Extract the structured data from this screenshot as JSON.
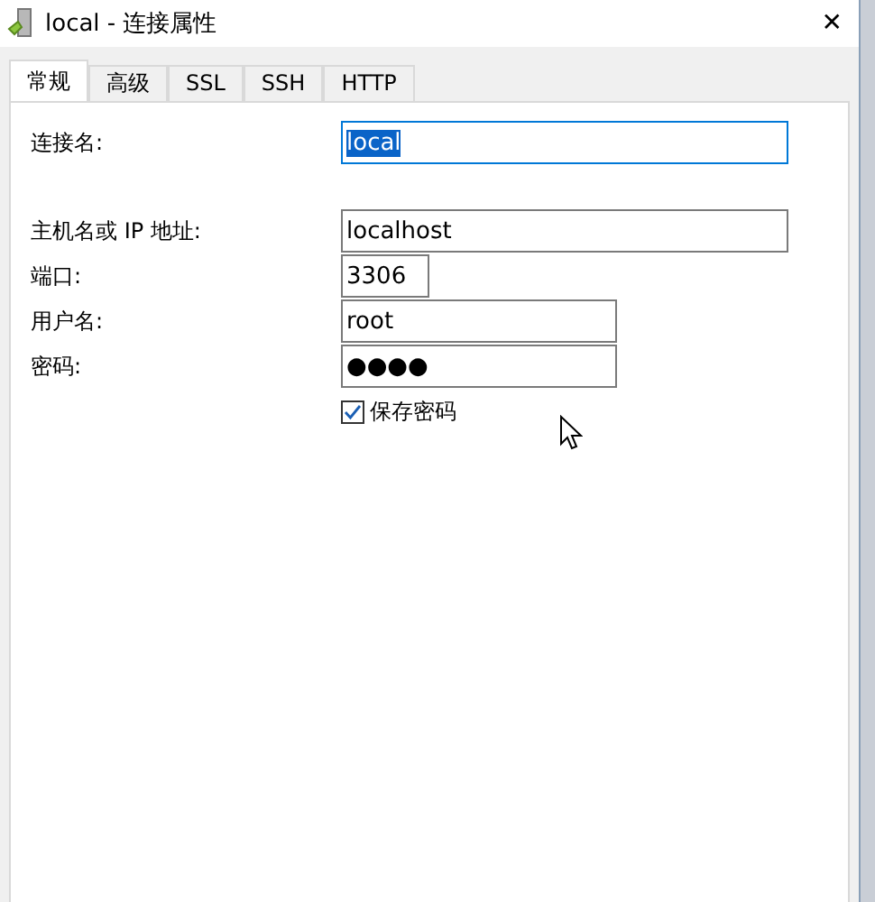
{
  "window": {
    "title": "local - 连接属性",
    "close": "✕"
  },
  "tabs": [
    {
      "label": "常规",
      "selected": true
    },
    {
      "label": "高级",
      "selected": false
    },
    {
      "label": "SSL",
      "selected": false
    },
    {
      "label": "SSH",
      "selected": false
    },
    {
      "label": "HTTP",
      "selected": false
    }
  ],
  "fields": [
    {
      "label": "连接名:",
      "value": "local",
      "focused": true,
      "text_selected": true
    },
    {
      "label": "主机名或 IP 地址:",
      "value": "localhost",
      "focused": false,
      "text_selected": false
    },
    {
      "label": "端口:",
      "value": "3306",
      "focused": false,
      "text_selected": false
    },
    {
      "label": "用户名:",
      "value": "root",
      "focused": false,
      "text_selected": false
    },
    {
      "label": "密码:",
      "value": "●●●●",
      "focused": false,
      "text_selected": false
    }
  ],
  "save_password": {
    "label": "保存密码",
    "checked": true
  }
}
